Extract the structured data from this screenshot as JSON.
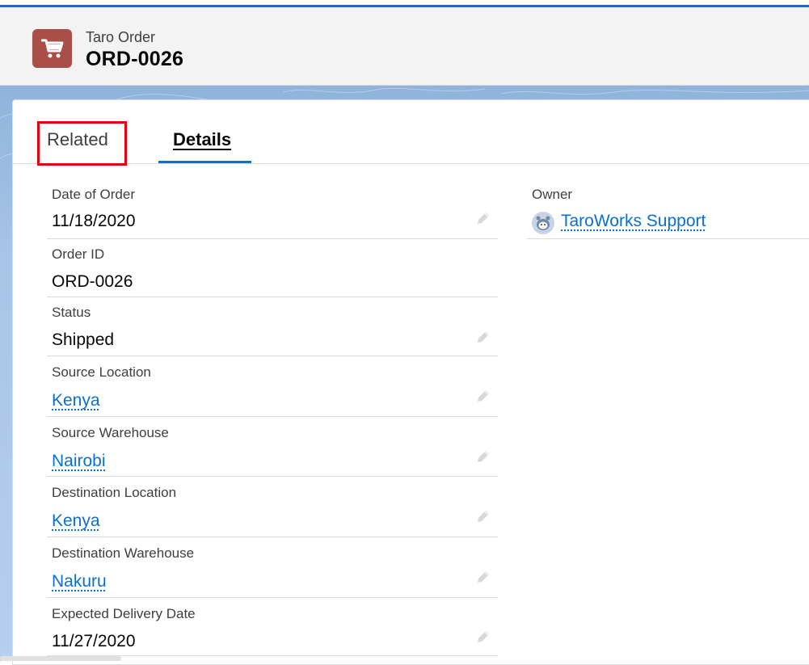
{
  "header": {
    "object_label": "Taro Order",
    "record_name": "ORD-0026",
    "icon": "shopping-cart-icon",
    "icon_color": "#a94e49"
  },
  "tabs": [
    {
      "label": "Related",
      "active": false
    },
    {
      "label": "Details",
      "active": true
    }
  ],
  "fields": [
    {
      "label": "Date of Order",
      "value": "11/18/2020",
      "link": false,
      "editable": true
    },
    {
      "label": "Order ID",
      "value": "ORD-0026",
      "link": false,
      "editable": false
    },
    {
      "label": "Status",
      "value": "Shipped",
      "link": false,
      "editable": true
    },
    {
      "label": "Source Location",
      "value": "Kenya",
      "link": true,
      "editable": true
    },
    {
      "label": "Source Warehouse",
      "value": "Nairobi",
      "link": true,
      "editable": true
    },
    {
      "label": "Destination Location",
      "value": "Kenya",
      "link": true,
      "editable": true
    },
    {
      "label": "Destination Warehouse",
      "value": "Nakuru",
      "link": true,
      "editable": true
    },
    {
      "label": "Expected Delivery Date",
      "value": "11/27/2020",
      "link": false,
      "editable": true
    }
  ],
  "owner": {
    "label": "Owner",
    "value": "TaroWorks Support",
    "icon": "user-avatar-icon"
  },
  "colors": {
    "accent": "#0b6fce",
    "highlight": "#e8000a",
    "brand_bar": "#1b6ac9"
  }
}
